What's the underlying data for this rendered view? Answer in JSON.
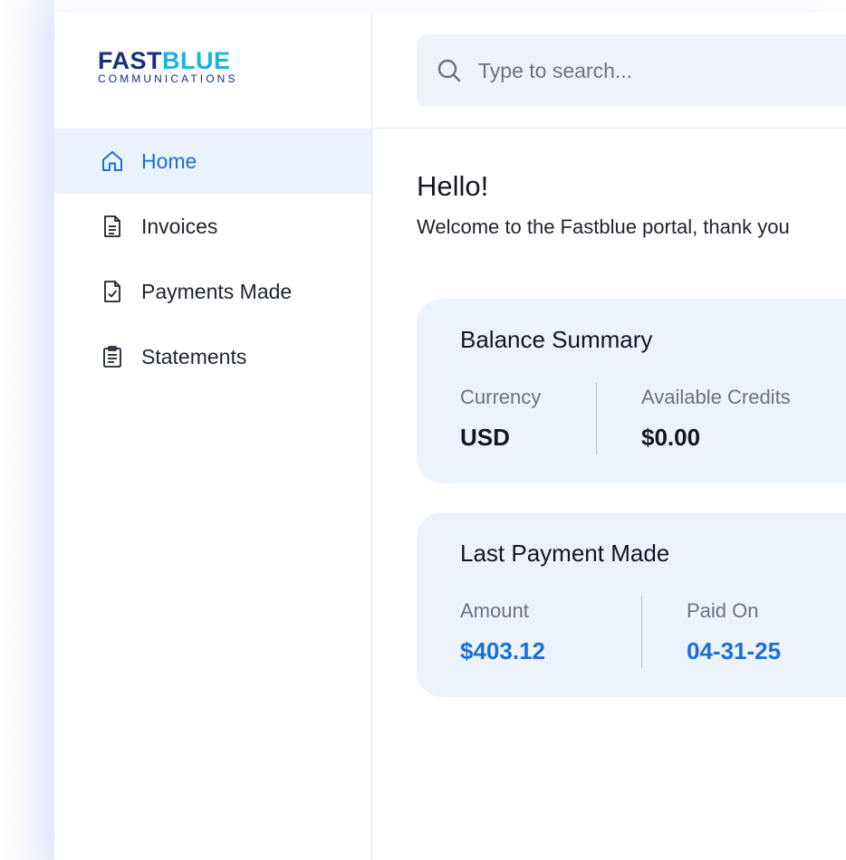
{
  "brand": {
    "name_part1": "FAST",
    "name_part2": "BLUE",
    "subtitle": "COMMUNICATIONS",
    "colors": {
      "dark": "#16307a",
      "light": "#1cb3e3"
    }
  },
  "sidebar": {
    "items": [
      {
        "label": "Home",
        "icon": "home-icon",
        "active": true
      },
      {
        "label": "Invoices",
        "icon": "document-icon",
        "active": false
      },
      {
        "label": "Payments Made",
        "icon": "document-check-icon",
        "active": false
      },
      {
        "label": "Statements",
        "icon": "clipboard-icon",
        "active": false
      }
    ]
  },
  "search": {
    "placeholder": "Type to search...",
    "icon": "search-icon"
  },
  "main": {
    "greeting": "Hello!",
    "welcome": "Welcome to the Fastblue portal, thank you"
  },
  "balance_summary": {
    "title": "Balance Summary",
    "currency_label": "Currency",
    "currency_value": "USD",
    "credits_label": "Available Credits",
    "credits_value": "$0.00"
  },
  "last_payment": {
    "title": "Last Payment Made",
    "amount_label": "Amount",
    "amount_value": "$403.12",
    "paid_on_label": "Paid On",
    "paid_on_value": "04-31-25"
  },
  "colors": {
    "accent": "#1a6fd8",
    "active_bg": "#eaf2fb",
    "card_bg": "#edf3fa"
  }
}
